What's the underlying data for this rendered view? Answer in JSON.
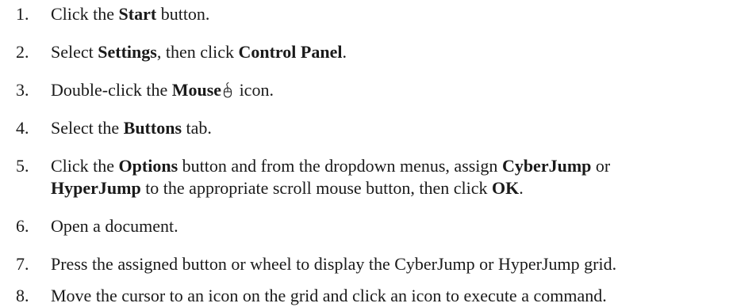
{
  "steps": [
    {
      "num": "1.",
      "parts": [
        {
          "t": "Click the "
        },
        {
          "b": "Start"
        },
        {
          "t": " button."
        }
      ]
    },
    {
      "num": "2.",
      "parts": [
        {
          "t": "Select "
        },
        {
          "b": "Settings"
        },
        {
          "t": ", then click "
        },
        {
          "b": "Control Panel"
        },
        {
          "t": "."
        }
      ]
    },
    {
      "num": "3.",
      "parts": [
        {
          "t": "Double-click the "
        },
        {
          "b": "Mouse"
        },
        {
          "icon": "mouse-icon"
        },
        {
          "t": " icon."
        }
      ]
    },
    {
      "num": "4.",
      "parts": [
        {
          "t": "Select the "
        },
        {
          "b": "Buttons"
        },
        {
          "t": " tab."
        }
      ]
    },
    {
      "num": "5.",
      "lines": [
        [
          {
            "t": "Click the "
          },
          {
            "b": "Options"
          },
          {
            "t": " button and from the dropdown menus, assign "
          },
          {
            "b": "CyberJump"
          },
          {
            "t": " or"
          }
        ],
        [
          {
            "b": "HyperJump"
          },
          {
            "t": " to the appropriate scroll mouse button, then click "
          },
          {
            "b": "OK"
          },
          {
            "t": "."
          }
        ]
      ]
    },
    {
      "num": "6.",
      "parts": [
        {
          "t": "Open a document."
        }
      ]
    },
    {
      "num": "7.",
      "parts": [
        {
          "t": "Press the assigned button or wheel to display the CyberJump or HyperJump grid."
        }
      ]
    },
    {
      "num": "8.",
      "parts": [
        {
          "t": "Move the cursor to an icon on the grid and click an icon to execute a command."
        }
      ]
    }
  ]
}
